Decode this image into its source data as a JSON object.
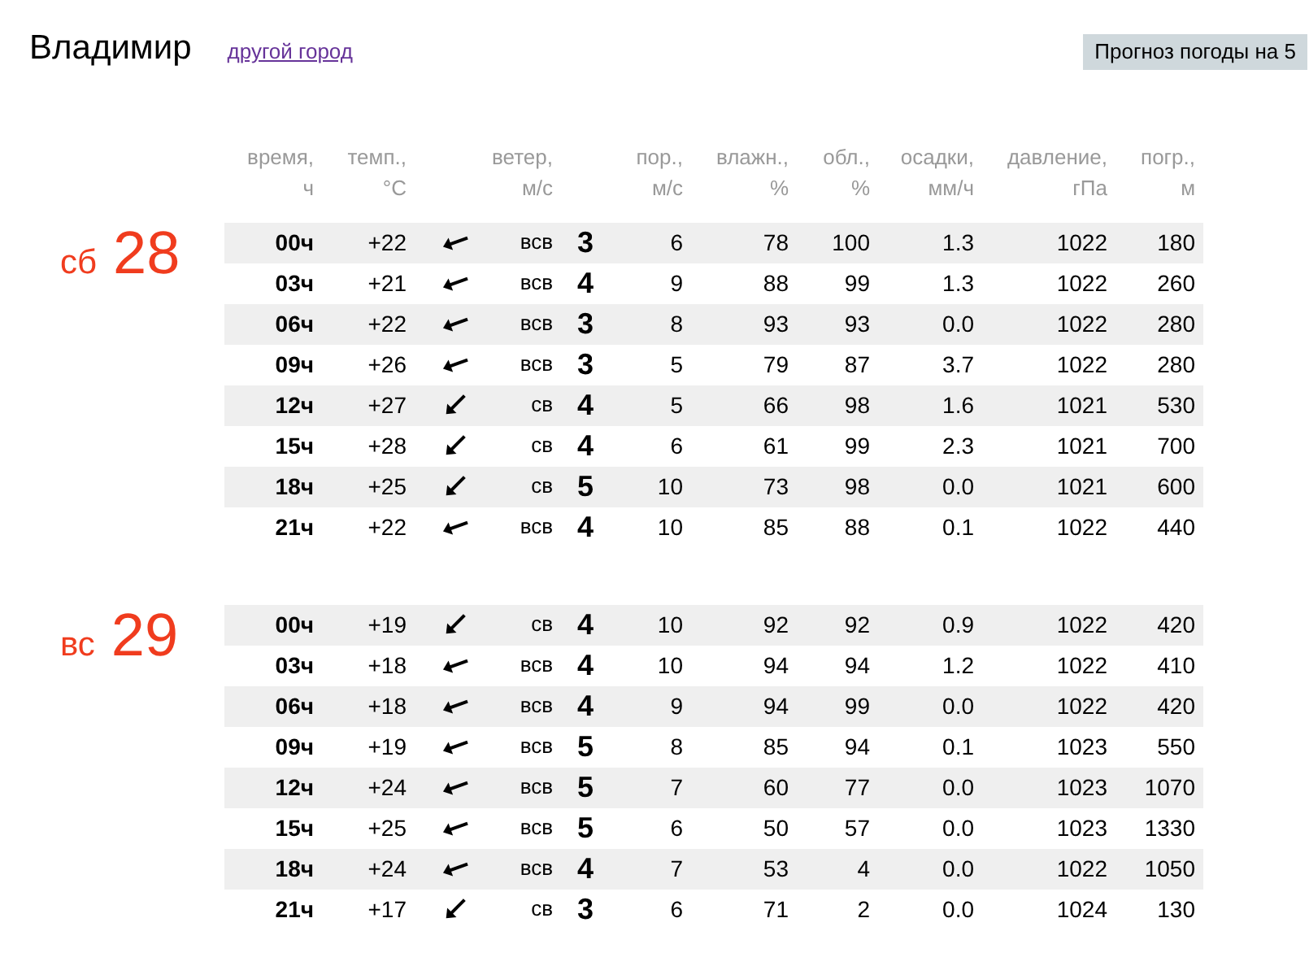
{
  "header": {
    "city": "Владимир",
    "change_city_link": "другой город",
    "forecast_button": "Прогноз погоды на 5"
  },
  "columns": [
    {
      "line1": "время,",
      "line2": "ч"
    },
    {
      "line1": "темп.,",
      "line2": "°C"
    },
    {
      "line1": "ветер,",
      "line2": "м/с"
    },
    {
      "line1": "пор.,",
      "line2": "м/с"
    },
    {
      "line1": "влажн.,",
      "line2": "%"
    },
    {
      "line1": "обл.,",
      "line2": "%"
    },
    {
      "line1": "осадки,",
      "line2": "мм/ч"
    },
    {
      "line1": "давление,",
      "line2": "гПа"
    },
    {
      "line1": "погр.,",
      "line2": "м"
    }
  ],
  "days": [
    {
      "weekday": "сб",
      "date": "28",
      "rows": [
        {
          "time": "00ч",
          "temp": "+22",
          "kind": "ene",
          "dir": "всв",
          "wind": "3",
          "gust": "6",
          "humidity": "78",
          "clouds": "100",
          "precip": "1.3",
          "pressure": "1022",
          "visibility": "180"
        },
        {
          "time": "03ч",
          "temp": "+21",
          "kind": "ene",
          "dir": "всв",
          "wind": "4",
          "gust": "9",
          "humidity": "88",
          "clouds": "99",
          "precip": "1.3",
          "pressure": "1022",
          "visibility": "260"
        },
        {
          "time": "06ч",
          "temp": "+22",
          "kind": "ene",
          "dir": "всв",
          "wind": "3",
          "gust": "8",
          "humidity": "93",
          "clouds": "93",
          "precip": "0.0",
          "pressure": "1022",
          "visibility": "280"
        },
        {
          "time": "09ч",
          "temp": "+26",
          "kind": "ene",
          "dir": "всв",
          "wind": "3",
          "gust": "5",
          "humidity": "79",
          "clouds": "87",
          "precip": "3.7",
          "pressure": "1022",
          "visibility": "280"
        },
        {
          "time": "12ч",
          "temp": "+27",
          "kind": "ne",
          "dir": "св",
          "wind": "4",
          "gust": "5",
          "humidity": "66",
          "clouds": "98",
          "precip": "1.6",
          "pressure": "1021",
          "visibility": "530"
        },
        {
          "time": "15ч",
          "temp": "+28",
          "kind": "ne",
          "dir": "св",
          "wind": "4",
          "gust": "6",
          "humidity": "61",
          "clouds": "99",
          "precip": "2.3",
          "pressure": "1021",
          "visibility": "700"
        },
        {
          "time": "18ч",
          "temp": "+25",
          "kind": "ne",
          "dir": "св",
          "wind": "5",
          "gust": "10",
          "humidity": "73",
          "clouds": "98",
          "precip": "0.0",
          "pressure": "1021",
          "visibility": "600"
        },
        {
          "time": "21ч",
          "temp": "+22",
          "kind": "ene",
          "dir": "всв",
          "wind": "4",
          "gust": "10",
          "humidity": "85",
          "clouds": "88",
          "precip": "0.1",
          "pressure": "1022",
          "visibility": "440"
        }
      ]
    },
    {
      "weekday": "вс",
      "date": "29",
      "rows": [
        {
          "time": "00ч",
          "temp": "+19",
          "kind": "ne",
          "dir": "св",
          "wind": "4",
          "gust": "10",
          "humidity": "92",
          "clouds": "92",
          "precip": "0.9",
          "pressure": "1022",
          "visibility": "420"
        },
        {
          "time": "03ч",
          "temp": "+18",
          "kind": "ene",
          "dir": "всв",
          "wind": "4",
          "gust": "10",
          "humidity": "94",
          "clouds": "94",
          "precip": "1.2",
          "pressure": "1022",
          "visibility": "410"
        },
        {
          "time": "06ч",
          "temp": "+18",
          "kind": "ene",
          "dir": "всв",
          "wind": "4",
          "gust": "9",
          "humidity": "94",
          "clouds": "99",
          "precip": "0.0",
          "pressure": "1022",
          "visibility": "420"
        },
        {
          "time": "09ч",
          "temp": "+19",
          "kind": "ene",
          "dir": "всв",
          "wind": "5",
          "gust": "8",
          "humidity": "85",
          "clouds": "94",
          "precip": "0.1",
          "pressure": "1023",
          "visibility": "550"
        },
        {
          "time": "12ч",
          "temp": "+24",
          "kind": "ene",
          "dir": "всв",
          "wind": "5",
          "gust": "7",
          "humidity": "60",
          "clouds": "77",
          "precip": "0.0",
          "pressure": "1023",
          "visibility": "1070"
        },
        {
          "time": "15ч",
          "temp": "+25",
          "kind": "ene",
          "dir": "всв",
          "wind": "5",
          "gust": "6",
          "humidity": "50",
          "clouds": "57",
          "precip": "0.0",
          "pressure": "1023",
          "visibility": "1330"
        },
        {
          "time": "18ч",
          "temp": "+24",
          "kind": "ene",
          "dir": "всв",
          "wind": "4",
          "gust": "7",
          "humidity": "53",
          "clouds": "4",
          "precip": "0.0",
          "pressure": "1022",
          "visibility": "1050"
        },
        {
          "time": "21ч",
          "temp": "+17",
          "kind": "ne",
          "dir": "св",
          "wind": "3",
          "gust": "6",
          "humidity": "71",
          "clouds": "2",
          "precip": "0.0",
          "pressure": "1024",
          "visibility": "130"
        }
      ]
    }
  ]
}
